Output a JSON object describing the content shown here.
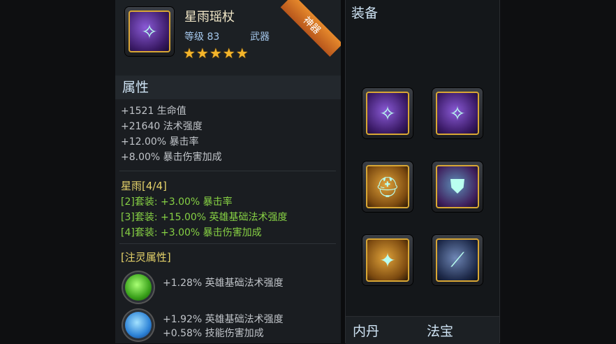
{
  "item": {
    "name": "星雨瑶杖",
    "level": "等级 83",
    "type": "武器",
    "stars": "★★★★★",
    "ribbon": "神器",
    "icon": "staff-icon"
  },
  "attributes": {
    "title": "属性",
    "lines": [
      "+1521 生命值",
      "+21640 法术强度",
      "+12.00% 暴击率",
      "+8.00% 暴击伤害加成"
    ]
  },
  "set": {
    "title": "星雨[4/4]",
    "lines": [
      "[2]套装: +3.00% 暴击率",
      "[3]套装: +15.00% 英雄基础法术强度",
      "[4]套装: +3.00% 暴击伤害加成"
    ]
  },
  "spirit": {
    "title": "[注灵属性]",
    "green": [
      "+1.28% 英雄基础法术强度"
    ],
    "blue": [
      "+1.92% 英雄基础法术强度",
      "+0.58% 技能伤害加成"
    ]
  },
  "equipment": {
    "title": "装备",
    "slots": [
      {
        "icon": "staff-icon"
      },
      {
        "icon": "staff-icon"
      },
      {
        "icon": "helmet-icon"
      },
      {
        "icon": "armor-icon"
      },
      {
        "icon": "boots-icon"
      },
      {
        "icon": "wand-icon"
      }
    ],
    "tabs": [
      "内丹",
      "法宝"
    ]
  },
  "colors": {
    "gold_border": "#d9a734",
    "set_green": "#86d044",
    "set_title_yellow": "#e6d36a"
  }
}
